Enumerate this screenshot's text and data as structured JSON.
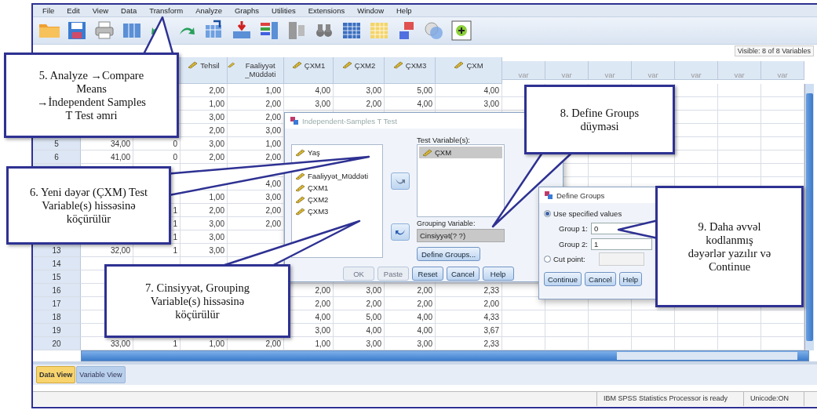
{
  "menu": [
    "File",
    "Edit",
    "View",
    "Data",
    "Transform",
    "Analyze",
    "Graphs",
    "Utilities",
    "Extensions",
    "Window",
    "Help"
  ],
  "visible_label": "Visible: 8 of 8 Variables",
  "columns": [
    null,
    null,
    {
      "label": "Tehsil",
      "kind": "variable"
    },
    {
      "label": "Faaliyyət _Müddəti",
      "kind": "variable"
    },
    {
      "label": "ÇXM1",
      "kind": "variable"
    },
    {
      "label": "ÇXM2",
      "kind": "variable"
    },
    {
      "label": "ÇXM3",
      "kind": "variable"
    },
    {
      "label": "ÇXM",
      "kind": "variable"
    },
    {
      "label": "var",
      "kind": "empty"
    },
    {
      "label": "var",
      "kind": "empty"
    },
    {
      "label": "var",
      "kind": "empty"
    },
    {
      "label": "var",
      "kind": "empty"
    },
    {
      "label": "var",
      "kind": "empty"
    },
    {
      "label": "var",
      "kind": "empty"
    },
    {
      "label": "var",
      "kind": "empty"
    }
  ],
  "rows": [
    {
      "number": null,
      "cells": [
        null,
        null,
        "2,00",
        "1,00",
        "4,00",
        "3,00",
        "5,00",
        "4,00"
      ]
    },
    {
      "number": null,
      "cells": [
        null,
        null,
        "1,00",
        "2,00",
        "3,00",
        "2,00",
        "4,00",
        "3,00"
      ]
    },
    {
      "number": null,
      "cells": [
        null,
        null,
        "3,00",
        "2,00",
        null,
        null,
        null,
        null
      ]
    },
    {
      "number": null,
      "cells": [
        null,
        null,
        "2,00",
        "3,00",
        null,
        null,
        null,
        null
      ]
    },
    {
      "number": "5",
      "cells": [
        "34,00",
        "0",
        "3,00",
        "1,00",
        null,
        null,
        null,
        null
      ]
    },
    {
      "number": "6",
      "cells": [
        "41,00",
        "0",
        "2,00",
        "2,00",
        null,
        null,
        null,
        null
      ]
    },
    {
      "number": null,
      "cells": [
        null,
        null,
        null,
        null,
        null,
        null,
        null,
        null
      ]
    },
    {
      "number": null,
      "cells": [
        null,
        null,
        null,
        "4,00",
        null,
        null,
        null,
        null
      ]
    },
    {
      "number": null,
      "cells": [
        null,
        null,
        "1,00",
        "3,00",
        null,
        null,
        null,
        null
      ]
    },
    {
      "number": null,
      "cells": [
        null,
        "1",
        "2,00",
        "2,00",
        null,
        null,
        null,
        null
      ]
    },
    {
      "number": null,
      "cells": [
        null,
        "1",
        "3,00",
        "2,00",
        null,
        null,
        null,
        null
      ]
    },
    {
      "number": null,
      "cells": [
        null,
        "1",
        "3,00",
        null,
        null,
        null,
        null,
        null
      ]
    },
    {
      "number": "13",
      "cells": [
        "32,00",
        "1",
        "3,00",
        null,
        null,
        null,
        null,
        null
      ]
    },
    {
      "number": "14",
      "cells": [
        null,
        null,
        null,
        null,
        null,
        null,
        null,
        null
      ]
    },
    {
      "number": "15",
      "cells": [
        null,
        null,
        null,
        null,
        null,
        null,
        null,
        null
      ]
    },
    {
      "number": "16",
      "cells": [
        null,
        null,
        null,
        null,
        "2,00",
        "3,00",
        "2,00",
        "2,33"
      ]
    },
    {
      "number": "17",
      "cells": [
        null,
        null,
        null,
        null,
        "2,00",
        "2,00",
        "2,00",
        "2,00"
      ]
    },
    {
      "number": "18",
      "cells": [
        null,
        null,
        null,
        null,
        "4,00",
        "5,00",
        "4,00",
        "4,33"
      ]
    },
    {
      "number": "19",
      "cells": [
        null,
        null,
        null,
        null,
        "3,00",
        "4,00",
        "4,00",
        "3,67"
      ]
    },
    {
      "number": "20",
      "cells": [
        "33,00",
        "1",
        "1,00",
        "2,00",
        "1,00",
        "3,00",
        "3,00",
        "2,33"
      ]
    }
  ],
  "dialog": {
    "title": "Independent-Samples T Test",
    "source_items": [
      "Yaş",
      "Faaliyyət_Müddəti",
      "ÇXM1",
      "ÇXM2",
      "ÇXM3"
    ],
    "test_label": "Test Variable(s):",
    "test_items": [
      {
        "label": "ÇXM",
        "selected": true
      }
    ],
    "grouping_label": "Grouping Variable:",
    "grouping_value": "Cinsiyyət(? ?)",
    "define_button": "Define Groups...",
    "buttons": [
      {
        "label": "OK",
        "disabled": true
      },
      {
        "label": "Paste",
        "disabled": true
      },
      {
        "label": "Reset",
        "disabled": false
      },
      {
        "label": "Cancel",
        "disabled": false
      },
      {
        "label": "Help",
        "disabled": false
      }
    ]
  },
  "define_groups": {
    "title": "Define Groups",
    "options": [
      {
        "label": "Use specified values",
        "selected": true,
        "kind": "values"
      },
      {
        "label": "Cut point:",
        "selected": false,
        "kind": "cut"
      }
    ],
    "groups": [
      {
        "label": "Group 1:",
        "value": "0"
      },
      {
        "label": "Group 2:",
        "value": "1"
      }
    ],
    "buttons": [
      "Continue",
      "Cancel",
      "Help"
    ]
  },
  "tabs": [
    {
      "label": "Data View",
      "selected": true
    },
    {
      "label": "Variable View",
      "selected": false
    }
  ],
  "status": [
    "IBM SPSS Statistics Processor is ready",
    "Unicode:ON"
  ],
  "callouts": [
    "5. Analyze →Compare\nMeans\n→İndependent Samples\nT Test əmri",
    "6. Yeni dəyər (ÇXM) Test\nVariable(s) hissəsinə\nköçürülür",
    "7. Cinsiyyət, Grouping\nVariable(s) hissəsinə\nköçürülür",
    "8. Define Groups\ndüyməsi",
    "9. Daha əvvəl\nkodlanmış\ndəyərlər yazılır və\nContinue"
  ]
}
